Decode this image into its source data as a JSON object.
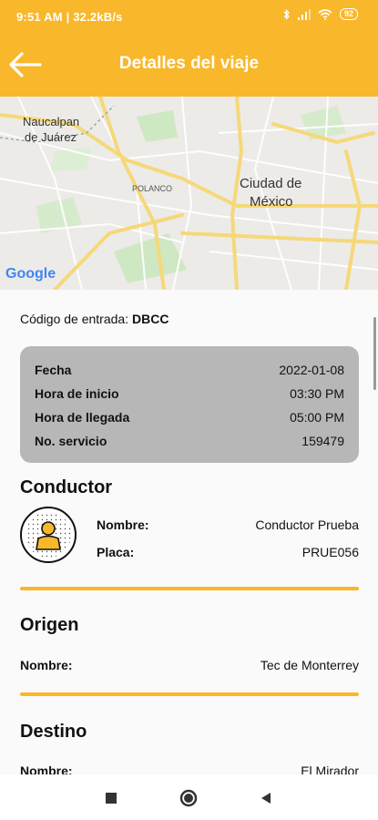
{
  "status_bar": {
    "time_speed": "9:51 AM | 32.2kB/s",
    "battery": "92"
  },
  "header": {
    "title": "Detalles del viaje"
  },
  "map": {
    "labels": {
      "naucalpan_1": "Naucalpan",
      "naucalpan_2": "de Juárez",
      "polanco": "POLANCO",
      "cdmx_1": "Ciudad de",
      "cdmx_2": "México"
    },
    "logo": "Google"
  },
  "entry_code": {
    "label": "Código de entrada:",
    "value": "DBCC"
  },
  "trip_info": [
    {
      "label": "Fecha",
      "value": "2022-01-08"
    },
    {
      "label": "Hora de inicio",
      "value": "03:30 PM"
    },
    {
      "label": "Hora de llegada",
      "value": "05:00 PM"
    },
    {
      "label": "No. servicio",
      "value": "159479"
    }
  ],
  "driver": {
    "title": "Conductor",
    "name_label": "Nombre:",
    "name_value": "Conductor Prueba",
    "plate_label": "Placa:",
    "plate_value": "PRUE056"
  },
  "origin": {
    "title": "Origen",
    "name_label": "Nombre:",
    "name_value": "Tec de Monterrey"
  },
  "destination": {
    "title": "Destino",
    "name_label": "Nombre:",
    "name_value": "El Mirador"
  },
  "colors": {
    "accent": "#F9B72B",
    "card": "#B7B7B7"
  },
  "icons": {
    "back": "arrow-left-icon",
    "avatar": "person-icon",
    "nav": [
      "stop-icon",
      "home-icon",
      "back-triangle-icon"
    ]
  }
}
